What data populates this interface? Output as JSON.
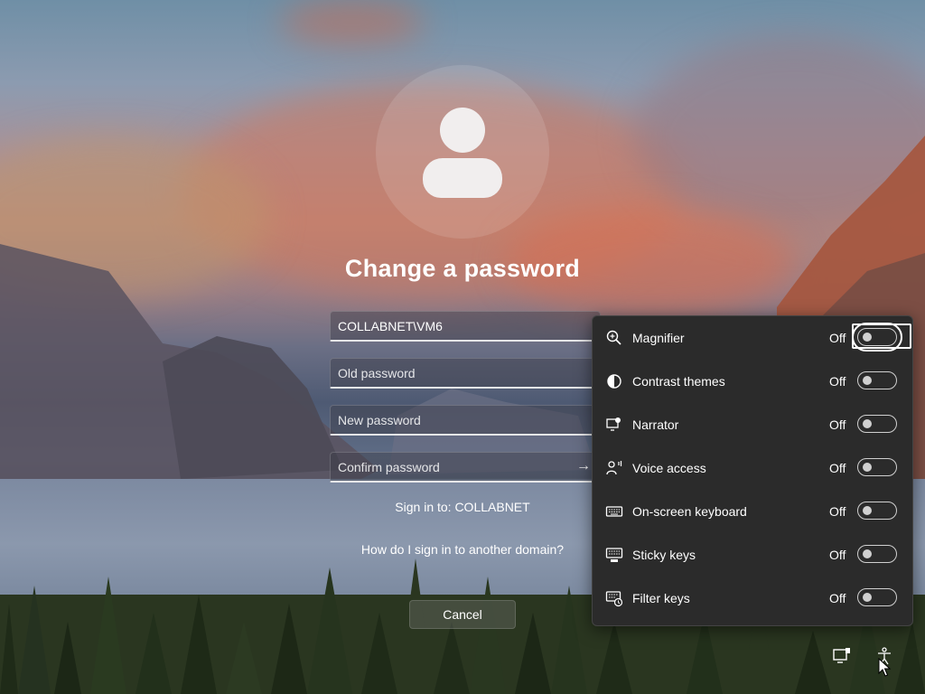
{
  "login": {
    "title": "Change a password",
    "username_value": "COLLABNET\\VM6",
    "old_password_placeholder": "Old password",
    "new_password_placeholder": "New password",
    "confirm_password_placeholder": "Confirm password",
    "sign_in_to": "Sign in to: COLLABNET",
    "other_domain_link": "How do I sign in to another domain?",
    "cancel_label": "Cancel"
  },
  "accessibility": {
    "items": [
      {
        "label": "Magnifier",
        "state": "Off",
        "icon": "magnifier-icon"
      },
      {
        "label": "Contrast themes",
        "state": "Off",
        "icon": "contrast-icon"
      },
      {
        "label": "Narrator",
        "state": "Off",
        "icon": "narrator-icon"
      },
      {
        "label": "Voice access",
        "state": "Off",
        "icon": "voice-access-icon"
      },
      {
        "label": "On-screen keyboard",
        "state": "Off",
        "icon": "keyboard-icon"
      },
      {
        "label": "Sticky keys",
        "state": "Off",
        "icon": "sticky-keys-icon"
      },
      {
        "label": "Filter keys",
        "state": "Off",
        "icon": "filter-keys-icon"
      }
    ]
  },
  "tray": {
    "icons": [
      "network-icon",
      "accessibility-icon"
    ]
  }
}
